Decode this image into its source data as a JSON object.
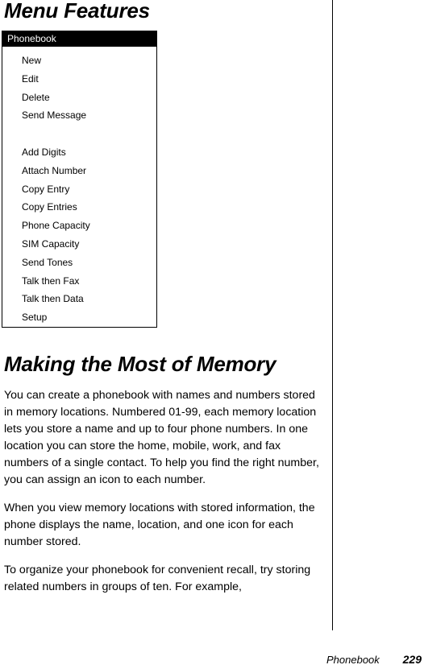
{
  "page": {
    "title": "Menu Features"
  },
  "menu_illustration": {
    "header_label": "Phonebook",
    "items": [
      {
        "label": "New",
        "spacer": false
      },
      {
        "label": "Edit",
        "spacer": false
      },
      {
        "label": "Delete",
        "spacer": false
      },
      {
        "label": "Send Message",
        "spacer": false
      },
      {
        "label": "",
        "spacer": true
      },
      {
        "label": "Add Digits",
        "spacer": false
      },
      {
        "label": "Attach Number",
        "spacer": false
      },
      {
        "label": "Copy Entry",
        "spacer": false
      },
      {
        "label": "Copy Entries",
        "spacer": false
      },
      {
        "label": "Phone Capacity",
        "spacer": false
      },
      {
        "label": "SIM Capacity",
        "spacer": false
      },
      {
        "label": "Send Tones",
        "spacer": false
      },
      {
        "label": "Talk then Fax",
        "spacer": false
      },
      {
        "label": "Talk then Data",
        "spacer": false
      },
      {
        "label": "Setup",
        "spacer": false
      }
    ]
  },
  "section": {
    "heading": "Making the Most of Memory",
    "paragraphs": [
      "You can create a phonebook with names and numbers stored in memory locations. Numbered 01-99, each memory location lets you store a name and up to four phone numbers. In one location you can store the home, mobile, work, and fax numbers of a single contact. To help you find the right number, you can assign an icon to each number.",
      "When you view memory locations with stored information, the phone displays the name, location, and one icon for each number stored.",
      "To organize your phonebook for convenient recall, try storing related numbers in groups of ten. For example,"
    ]
  },
  "footer": {
    "section_label": "Phonebook",
    "page_number": "229"
  },
  "colors": {
    "ink": "#000000",
    "paper": "#ffffff",
    "menu_header_bg": "#000000",
    "menu_header_text": "#ffffff"
  }
}
